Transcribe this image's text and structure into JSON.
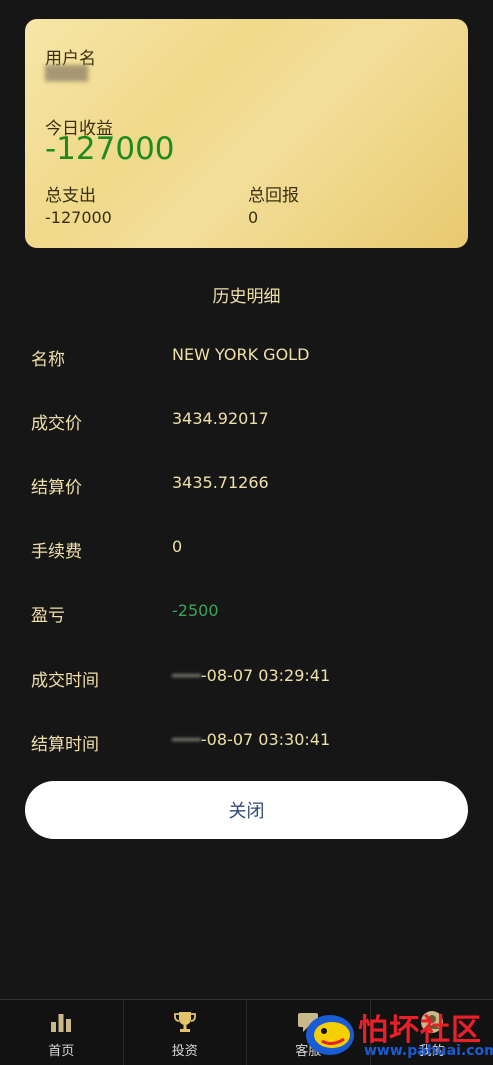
{
  "summary": {
    "username_label": "用户名",
    "username_value": "████",
    "today_label": "今日收益",
    "today_value": "-127000",
    "total_out_label": "总支出",
    "total_out_value": "-127000",
    "total_return_label": "总回报",
    "total_return_value": "0"
  },
  "history": {
    "title": "历史明细",
    "rows": [
      {
        "label": "名称",
        "value": "NEW YORK GOLD"
      },
      {
        "label": "成交价",
        "value": "3434.92017"
      },
      {
        "label": "结算价",
        "value": "3435.71266"
      },
      {
        "label": "手续费",
        "value": "0"
      },
      {
        "label": "盈亏",
        "value": "-2500"
      },
      {
        "label": "成交时间",
        "value_prefix": "━━━",
        "value": "-08-07 03:29:41"
      },
      {
        "label": "结算时间",
        "value_prefix": "━━━",
        "value": "-08-07 03:30:41"
      }
    ]
  },
  "close_label": "关闭",
  "tabs": [
    {
      "label": "首页",
      "icon": "bar-chart-icon"
    },
    {
      "label": "投资",
      "icon": "trophy-icon"
    },
    {
      "label": "客服",
      "icon": "chat-icon"
    },
    {
      "label": "我的",
      "icon": "user-icon"
    }
  ],
  "watermark": {
    "text": "怕坏社区",
    "url": "www.pahuai.com"
  },
  "colors": {
    "gold": "#f0d98a",
    "green": "#3aa55a",
    "background": "#161616"
  }
}
